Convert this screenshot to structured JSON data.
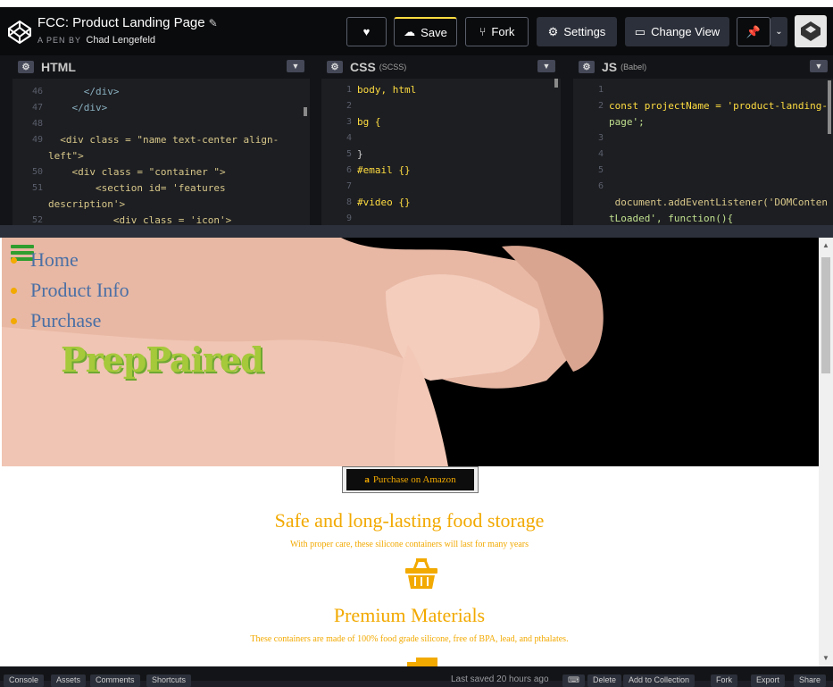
{
  "header": {
    "title": "FCC: Product Landing Page",
    "pen_by": "A PEN BY",
    "author": "Chad Lengefeld",
    "buttons": {
      "save": "Save",
      "fork": "Fork",
      "settings": "Settings",
      "change_view": "Change View"
    }
  },
  "editors": {
    "html": {
      "label": "HTML",
      "lines": [
        {
          "n": "46",
          "text": "      </div>"
        },
        {
          "n": "47",
          "text": "    </div>"
        },
        {
          "n": "48",
          "text": ""
        },
        {
          "n": "49",
          "text": "  <div class = \"name text-center align-"
        },
        {
          "n": "",
          "text": "left\">"
        },
        {
          "n": "50",
          "text": "    <div class = \"container \">"
        },
        {
          "n": "51",
          "text": "        <section id= 'features"
        },
        {
          "n": "",
          "text": "description'>"
        },
        {
          "n": "52",
          "text": "           <div class = 'icon'>"
        }
      ]
    },
    "css": {
      "label": "CSS",
      "sub": "(SCSS)",
      "lines": [
        {
          "n": "1",
          "text": "body, html"
        },
        {
          "n": "2",
          "text": ""
        },
        {
          "n": "3",
          "text": "bg {"
        },
        {
          "n": "4",
          "text": ""
        },
        {
          "n": "5",
          "text": "}"
        },
        {
          "n": "6",
          "text": "#email {}"
        },
        {
          "n": "7",
          "text": ""
        },
        {
          "n": "8",
          "text": "#video {}"
        },
        {
          "n": "9",
          "text": ""
        }
      ]
    },
    "js": {
      "label": "JS",
      "sub": "(Babel)",
      "lines": [
        {
          "n": "1",
          "text": ""
        },
        {
          "n": "2",
          "text": "const projectName = 'product-landing-"
        },
        {
          "n": "",
          "text": "page';"
        },
        {
          "n": "3",
          "text": ""
        },
        {
          "n": "4",
          "text": ""
        },
        {
          "n": "5",
          "text": ""
        },
        {
          "n": "6",
          "text": ""
        },
        {
          "n": "",
          "text": " document.addEventListener('DOMConten"
        },
        {
          "n": "",
          "text": "tLoaded', function(){"
        }
      ]
    }
  },
  "preview": {
    "nav": [
      "Home",
      "Product Info",
      "Purchase"
    ],
    "brand": "PrepPaired",
    "buy_button": "Purchase on Amazon",
    "features": [
      {
        "title": "Safe and long-lasting food storage",
        "desc": "With proper care, these silicone containers will last for many years",
        "icon": "basket-icon"
      },
      {
        "title": "Premium Materials",
        "desc": "These containers are made of 100% food grade silicone, free of BPA, lead, and pthalates.",
        "icon": "truck-icon"
      }
    ]
  },
  "footer": {
    "buttons": [
      "Console",
      "Assets",
      "Comments",
      "Shortcuts"
    ],
    "status": "Last saved 20 hours ago",
    "right_buttons": [
      "Delete",
      "Add to Collection",
      "Fork",
      "Export",
      "Share"
    ]
  },
  "colors": {
    "accent_yellow": "#ffdd40",
    "amazon_orange": "#f2a900",
    "nav_blue": "#4a6fa5",
    "brand_green": "#a5c93a"
  }
}
